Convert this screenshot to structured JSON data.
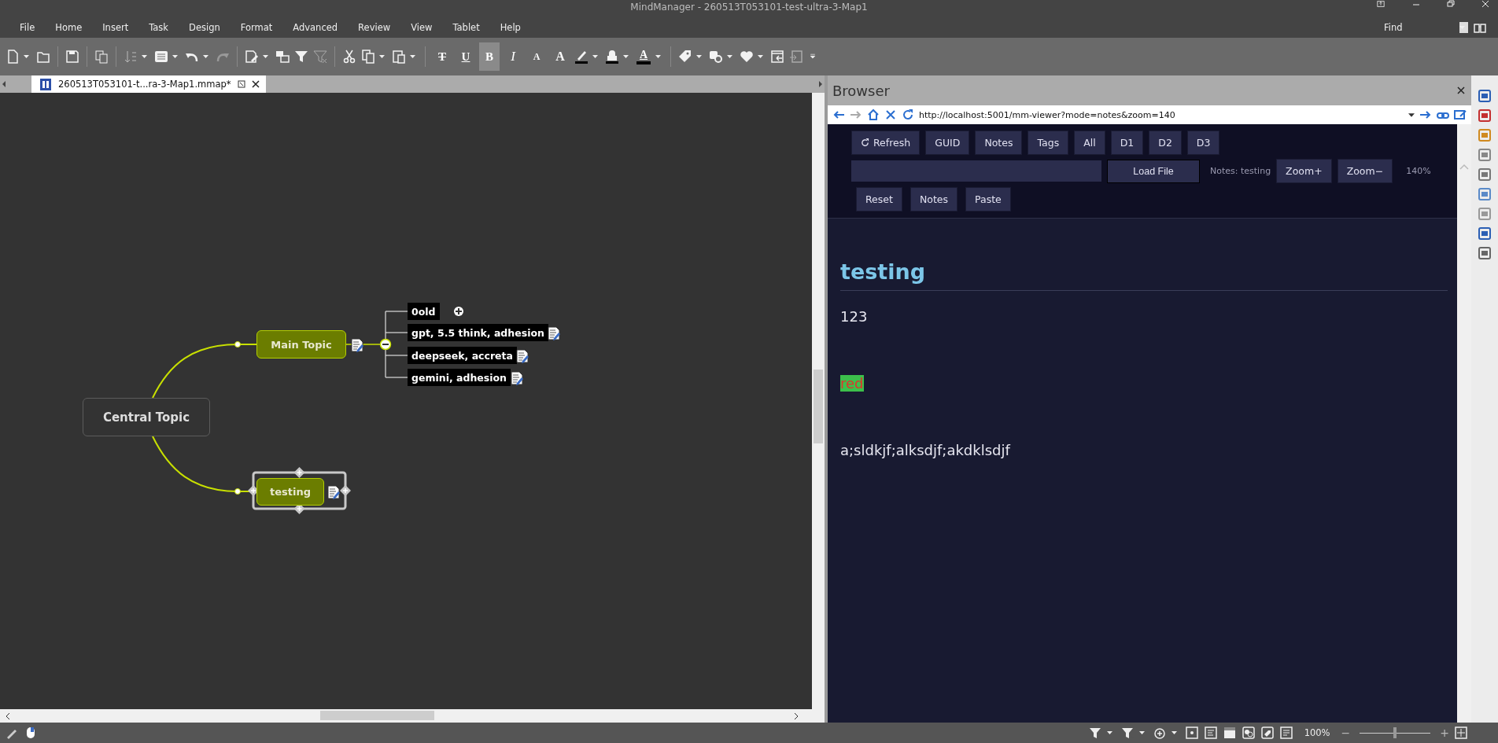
{
  "window": {
    "title": "MindManager - 260513T053101-test-ultra-3-Map1"
  },
  "menu": [
    "File",
    "Home",
    "Insert",
    "Task",
    "Design",
    "Format",
    "Advanced",
    "Review",
    "View",
    "Tablet",
    "Help"
  ],
  "find": {
    "label": "Find"
  },
  "format_buttons": [
    {
      "glyph": "T",
      "kind": "strike",
      "selected": false
    },
    {
      "glyph": "U",
      "kind": "underline",
      "selected": false
    },
    {
      "glyph": "B",
      "kind": "bold",
      "selected": true
    },
    {
      "glyph": "I",
      "kind": "italic",
      "selected": false
    },
    {
      "glyph": "A",
      "kind": "shrink",
      "selected": false
    },
    {
      "glyph": "A",
      "kind": "grow",
      "selected": false
    }
  ],
  "font_color_button": {
    "glyph": "A"
  },
  "document_tab": {
    "title": "260513T053101-t...ra-3-Map1.mmap*"
  },
  "map": {
    "central": {
      "text": "Central Topic"
    },
    "topics": [
      {
        "text": "Main Topic",
        "selected": false,
        "has_notes": true,
        "expanded": true,
        "children": [
          {
            "text": "0old",
            "has_notes": false,
            "collapsed": true
          },
          {
            "text": "gpt, 5.5 think, adhesion",
            "has_notes": true,
            "collapsed": false
          },
          {
            "text": "deepseek, accreta",
            "has_notes": true,
            "collapsed": false
          },
          {
            "text": "gemini, adhesion",
            "has_notes": true,
            "collapsed": false
          }
        ]
      },
      {
        "text": "testing",
        "selected": true,
        "has_notes": true
      }
    ]
  },
  "browser": {
    "title": "Browser",
    "url": "http://localhost:5001/mm-viewer?mode=notes&zoom=140",
    "row_1": [
      "Refresh",
      "GUID",
      "Notes",
      "Tags",
      "All",
      "D1",
      "D2",
      "D3"
    ],
    "load_button": "Load File",
    "notes_label": "Notes: testing",
    "zoom_in": "Zoom+",
    "zoom_out": "Zoom−",
    "zoom_reading": "140%",
    "row_3": [
      "Reset",
      "Notes",
      "Paste"
    ],
    "note": {
      "heading": "testing",
      "paragraphs": [
        {
          "text": "123",
          "kind": "plain"
        },
        {
          "text": "red",
          "kind": "highlight"
        },
        {
          "text": "a;sldkjf;alksdjf;akdklsdjf",
          "kind": "plain"
        }
      ]
    }
  },
  "status_bar": {
    "zoom": "100%",
    "zoom_minus": "−",
    "zoom_plus": "+",
    "zoom_slider": {
      "level": 0.5
    }
  }
}
